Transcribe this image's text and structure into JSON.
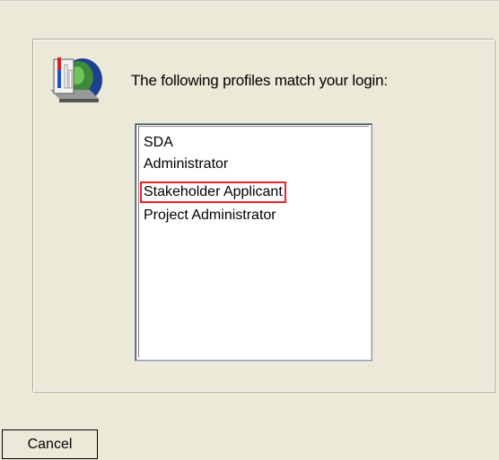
{
  "dialog": {
    "icon": "profile-server-icon",
    "prompt": "The following profiles match your login:",
    "profiles": [
      {
        "label": "SDA",
        "highlighted": false
      },
      {
        "label": "Administrator",
        "highlighted": false
      },
      {
        "label": "Stakeholder Applicant",
        "highlighted": true
      },
      {
        "label": "Project Administrator",
        "highlighted": false
      }
    ],
    "cancel_label": "Cancel"
  },
  "colors": {
    "background": "#ece9d8",
    "highlight_border": "#e8262b",
    "list_border": "#7f9db9"
  }
}
